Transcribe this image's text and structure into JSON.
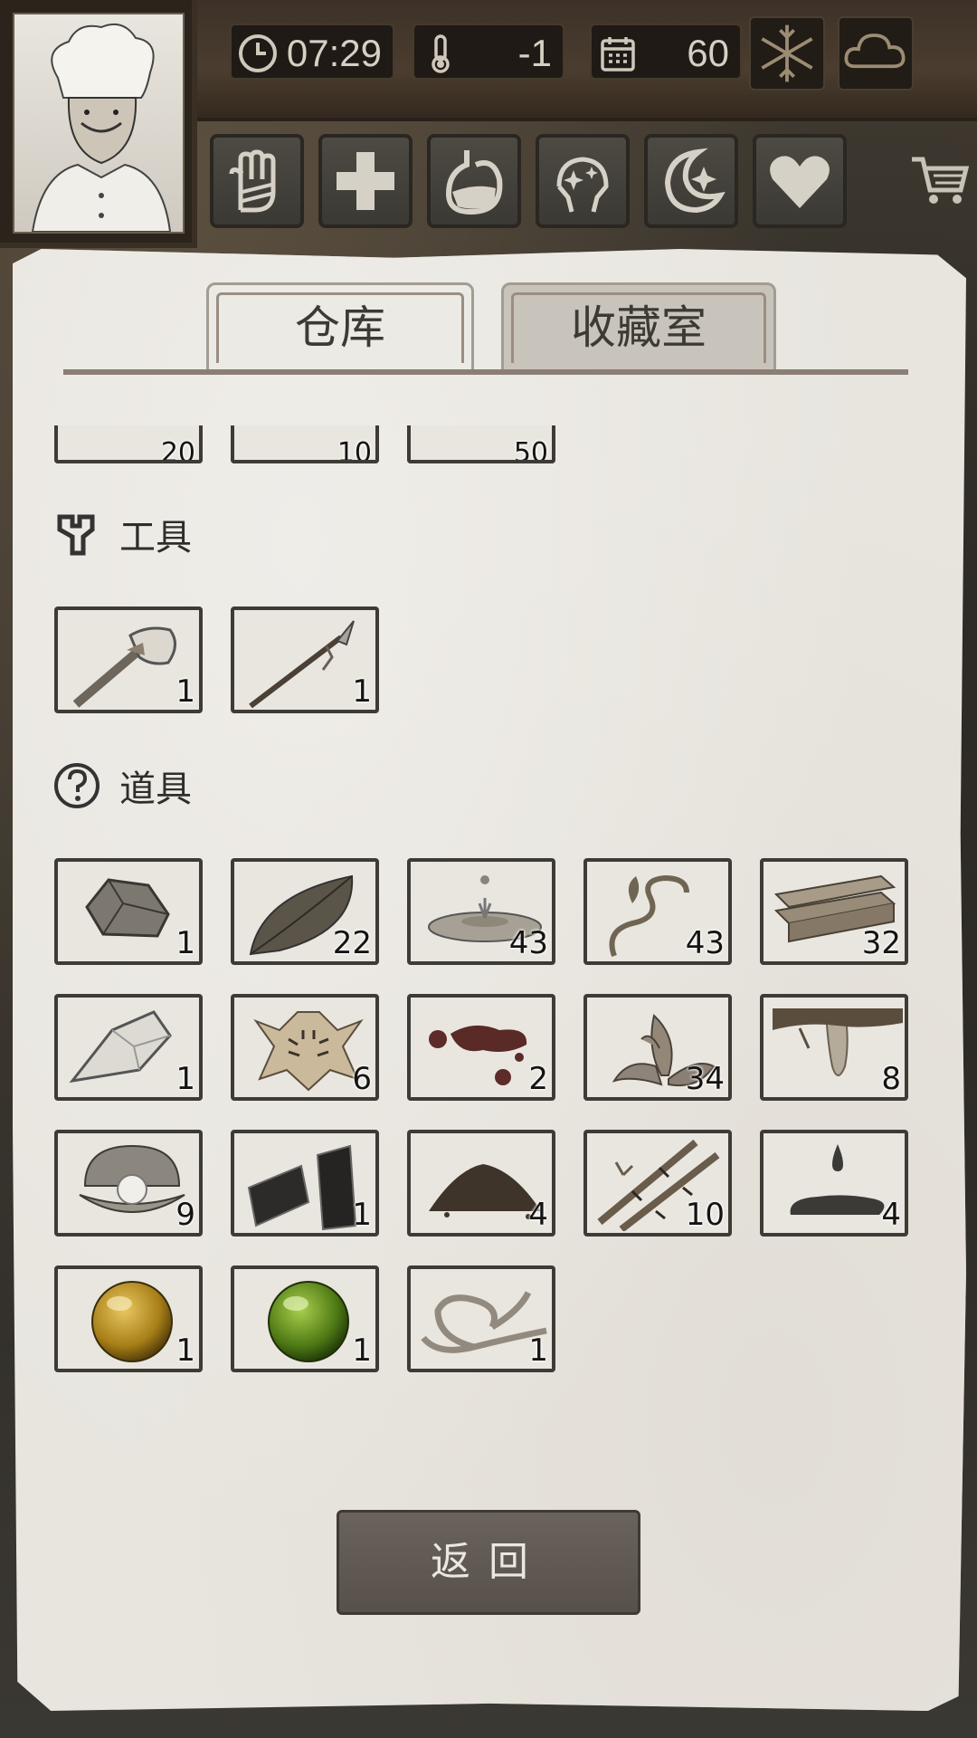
{
  "hud": {
    "time": "07:29",
    "temperature": "-1",
    "days": "60",
    "weather_icons": [
      "snowflake-icon",
      "cloud-icon"
    ]
  },
  "status_icons": [
    "hand-icon",
    "health-cross-icon",
    "stomach-icon",
    "mind-icon",
    "moon-icon",
    "heart-icon"
  ],
  "tabs": {
    "warehouse": "仓库",
    "collection": "收藏室"
  },
  "partial_row": {
    "counts": [
      "20",
      "10",
      "50"
    ]
  },
  "sections": {
    "tools": {
      "title": "工具",
      "items": [
        {
          "name": "stone-axe",
          "count": "1"
        },
        {
          "name": "stone-spear",
          "count": "1"
        }
      ]
    },
    "props": {
      "title": "道具",
      "items": [
        {
          "name": "stone",
          "count": "1"
        },
        {
          "name": "leaf",
          "count": "22"
        },
        {
          "name": "water",
          "count": "43"
        },
        {
          "name": "vine",
          "count": "43"
        },
        {
          "name": "planks",
          "count": "32"
        },
        {
          "name": "flint",
          "count": "1"
        },
        {
          "name": "tiger-pelt",
          "count": "6"
        },
        {
          "name": "blood",
          "count": "2"
        },
        {
          "name": "herb",
          "count": "34"
        },
        {
          "name": "resin",
          "count": "8"
        },
        {
          "name": "pearl",
          "count": "9"
        },
        {
          "name": "charcoal",
          "count": "1"
        },
        {
          "name": "soil",
          "count": "4"
        },
        {
          "name": "bamboo",
          "count": "10"
        },
        {
          "name": "oil",
          "count": "4"
        },
        {
          "name": "amber-orb",
          "count": "1"
        },
        {
          "name": "green-orb",
          "count": "1"
        },
        {
          "name": "rope",
          "count": "1"
        }
      ]
    }
  },
  "back_button": "返回",
  "colors": {
    "paper": "#e8e5df",
    "slot_border": "#3e3b37",
    "button": "#615a52"
  }
}
